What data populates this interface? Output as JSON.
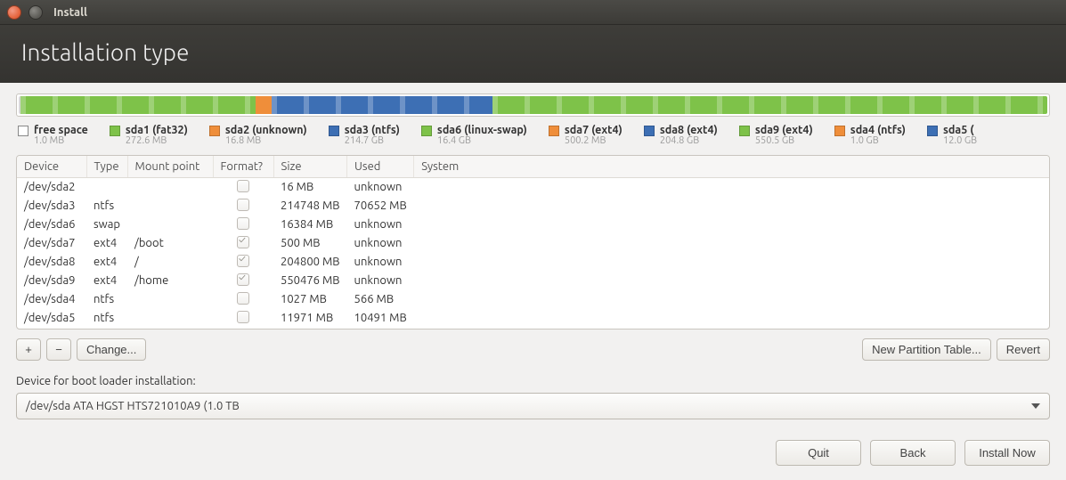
{
  "window": {
    "title": "Install"
  },
  "header": {
    "title": "Installation type"
  },
  "colors": {
    "green": "#7ec249",
    "orange": "#ef8e3a",
    "blue": "#3d6fb4",
    "grey": "#d9d9d9"
  },
  "partbar": [
    {
      "colorKey": "grey",
      "flex": 0.2
    },
    {
      "colorKey": "green",
      "flex": 22.8,
      "stripes": true
    },
    {
      "colorKey": "orange",
      "flex": 1.6
    },
    {
      "colorKey": "blue",
      "flex": 21.5,
      "stripes": true
    },
    {
      "colorKey": "green",
      "flex": 53.9,
      "stripes": true
    }
  ],
  "legend": [
    {
      "hollow": true,
      "label": "free space",
      "size": "1.0 MB"
    },
    {
      "colorKey": "green",
      "label": "sda1 (fat32)",
      "size": "272.6 MB"
    },
    {
      "colorKey": "orange",
      "label": "sda2 (unknown)",
      "size": "16.8 MB"
    },
    {
      "colorKey": "blue",
      "label": "sda3 (ntfs)",
      "size": "214.7 GB"
    },
    {
      "colorKey": "green",
      "label": "sda6 (linux-swap)",
      "size": "16.4 GB"
    },
    {
      "colorKey": "orange",
      "label": "sda7 (ext4)",
      "size": "500.2 MB"
    },
    {
      "colorKey": "blue",
      "label": "sda8 (ext4)",
      "size": "204.8 GB"
    },
    {
      "colorKey": "green",
      "label": "sda9 (ext4)",
      "size": "550.5 GB"
    },
    {
      "colorKey": "orange",
      "label": "sda4 (ntfs)",
      "size": "1.0 GB"
    },
    {
      "colorKey": "blue",
      "label": "sda5 (",
      "size": "12.0 GB"
    }
  ],
  "columns": {
    "device": "Device",
    "type": "Type",
    "mount": "Mount point",
    "format": "Format?",
    "size": "Size",
    "used": "Used",
    "system": "System"
  },
  "rows": [
    {
      "device": "/dev/sda2",
      "type": "",
      "mount": "",
      "format": false,
      "size": "16 MB",
      "used": "unknown",
      "system": ""
    },
    {
      "device": "/dev/sda3",
      "type": "ntfs",
      "mount": "",
      "format": false,
      "size": "214748 MB",
      "used": "70652 MB",
      "system": ""
    },
    {
      "device": "/dev/sda6",
      "type": "swap",
      "mount": "",
      "format": false,
      "size": "16384 MB",
      "used": "unknown",
      "system": ""
    },
    {
      "device": "/dev/sda7",
      "type": "ext4",
      "mount": "/boot",
      "format": true,
      "size": "500 MB",
      "used": "unknown",
      "system": ""
    },
    {
      "device": "/dev/sda8",
      "type": "ext4",
      "mount": "/",
      "format": true,
      "size": "204800 MB",
      "used": "unknown",
      "system": ""
    },
    {
      "device": "/dev/sda9",
      "type": "ext4",
      "mount": "/home",
      "format": true,
      "size": "550476 MB",
      "used": "unknown",
      "system": ""
    },
    {
      "device": "/dev/sda4",
      "type": "ntfs",
      "mount": "",
      "format": false,
      "size": "1027 MB",
      "used": "566 MB",
      "system": ""
    },
    {
      "device": "/dev/sda5",
      "type": "ntfs",
      "mount": "",
      "format": false,
      "size": "11971 MB",
      "used": "10491 MB",
      "system": ""
    }
  ],
  "toolbar": {
    "add": "+",
    "remove": "−",
    "change": "Change...",
    "newtable": "New Partition Table...",
    "revert": "Revert"
  },
  "bootloader": {
    "label": "Device for boot loader installation:",
    "value": "/dev/sda   ATA HGST HTS721010A9 (1.0 TB"
  },
  "footer": {
    "quit": "Quit",
    "back": "Back",
    "install": "Install Now"
  }
}
